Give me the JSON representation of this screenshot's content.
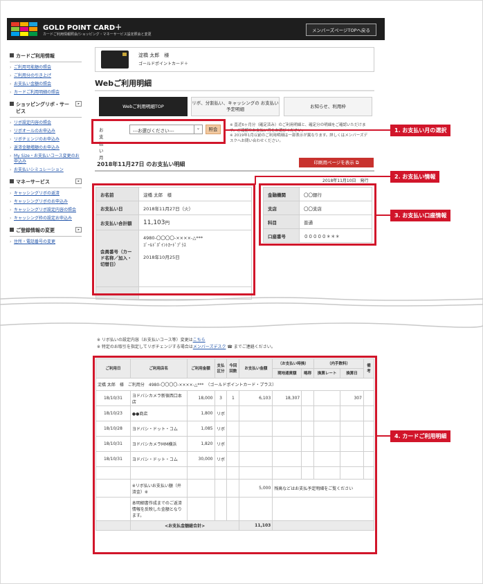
{
  "header": {
    "brand": "GOLD POINT CARD＋",
    "subtitle": "カードご利用情報照会/ショッピング・マネーサービス設定照会と変更",
    "member_top_button": "メンバーズページTOPへ戻る"
  },
  "sidebar": {
    "sections": [
      {
        "title": "カードご利用情報",
        "has_toggle": false,
        "items": [
          "ご利用可能額の照会",
          "ご利用分の引き上げ",
          "お支払い金額の照会",
          "カードご利用明細の照会"
        ]
      },
      {
        "title": "ショッピングリボ・サービス",
        "has_toggle": true,
        "items": [
          "リボ設定内容の照会",
          "リボオールのお申込み",
          "リボチェンジのお申込み",
          "返済金額増額のお申込み",
          "My Size・お支払いコース変更のお申込み",
          "お支払いシミュレーション"
        ]
      },
      {
        "title": "マネーサービス",
        "has_toggle": true,
        "items": [
          "キャッシングリボの返済",
          "キャッシングリボのお申込み",
          "キャッシングリボ設定内容の照会",
          "キャッシング枠の設定お申込み"
        ]
      },
      {
        "title": "ご登録情報の変更",
        "has_toggle": true,
        "items": [
          "住所・電話番号の変更"
        ]
      }
    ]
  },
  "card": {
    "holder": "淀橋 太郎　様",
    "type": "ゴールドポイントカード＋"
  },
  "page_title": "Webご利用明細",
  "tabs": [
    {
      "label": "Webご利用明細TOP"
    },
    {
      "label": "リボ、分割払い、キャッシングの お支払い予定明細"
    },
    {
      "label": "お知らせ、利用枠"
    }
  ],
  "month": {
    "label": "お支払い月",
    "selected": "---お選びください---",
    "view_button": "照会"
  },
  "notes": [
    "※ 直近6ヶ月分（確定済み）のご利用明細と、確定分の明細をご確認いただけます。ご確認のお支払い月をお選びください。",
    "※ 2019年1月以前のご利用明細は一部表示が異なります。詳しくはメンバーズデスクへお問い合わせください。"
  ],
  "statement_heading": "2018年11月27日 のお支払い明細",
  "print_button": "印刷用ページを表示",
  "issue_date": "2018年11月10日　発行",
  "payment_info": {
    "name_label": "お名前",
    "name": "淀橋 太郎　様",
    "date_label": "お支払い日",
    "date": "2018年11月27日（火）",
    "total_label": "お支払い合計額",
    "total": "11,103",
    "total_unit": "円",
    "member_label": "会員番号（カード名称／加入・切替日）",
    "member_no": "4980-〇〇〇〇-××××-△***",
    "member_card": "ｺﾞｰﾙﾄﾞﾎﾟｲﾝﾄｶｰﾄﾞﾌﾟﾗｽ",
    "member_date": "2018年10月25日"
  },
  "bank_info": {
    "bank_label": "金融機関",
    "bank": "〇〇銀行",
    "branch_label": "支店",
    "branch": "〇〇支店",
    "type_label": "科目",
    "type": "普通",
    "acct_label": "口座番号",
    "acct": "０００００＊＊＊"
  },
  "callouts": [
    "1. お支払い月の選択",
    "2. お支払い情報",
    "3. お支払い口座情報",
    "4. カードご利用明細"
  ],
  "lower_notes": {
    "line1_prefix": "※ リボ払いの設定内容（お支払いコース等）変更は",
    "line1_link": "こちら",
    "line2_prefix": "※ 特定のお取引を指定してリボチェンジする場合は",
    "line2_link": "メンバーズデスク",
    "line2_suffix": "までご連絡ください。"
  },
  "stmt": {
    "headers": {
      "date": "ご利用日",
      "shop": "ご利用店名",
      "amount": "ご利用金額",
      "kind": "支払区分",
      "count": "今回回数",
      "pay": "お支払い金額",
      "fx_group": "（お支払い時換）",
      "fx_local": "現地通貨額",
      "fx_abbr": "略称",
      "fee_group": "（内手数料）",
      "fee_rate": "換算レート",
      "fee_date": "換算日",
      "note": "備考"
    },
    "member_line": "淀橋 太郎　様　ご利用分　4980-〇〇〇〇-××××-△***　（ゴールドポイントカード・プラス）",
    "rows": [
      {
        "date": "18/10/31",
        "shop": "ヨドバシカメラ新宿西口本店",
        "amount": "18,000",
        "kind": "3",
        "count": "1",
        "pay": "6,103",
        "local": "18,307",
        "fee": "307"
      },
      {
        "date": "18/10/23",
        "shop": "●●商店",
        "amount": "1,800",
        "kind": "リボ",
        "count": "",
        "pay": "",
        "local": "",
        "fee": ""
      },
      {
        "date": "18/10/28",
        "shop": "ヨドバシ・ドット・コム",
        "amount": "1,085",
        "kind": "リボ",
        "count": "",
        "pay": "",
        "local": "",
        "fee": ""
      },
      {
        "date": "18/10/31",
        "shop": "ヨドバシカメラMM横浜",
        "amount": "1,820",
        "kind": "リボ",
        "count": "",
        "pay": "",
        "local": "",
        "fee": ""
      },
      {
        "date": "18/10/31",
        "shop": "ヨドバシ・ドット・コム",
        "amount": "30,000",
        "kind": "リボ",
        "count": "",
        "pay": "",
        "local": "",
        "fee": ""
      }
    ],
    "revo_label": "※リボ払いお支払い額（弁済金）※",
    "revo_amount": "5,000",
    "revo_note": "残高などはお支払予定明細をご覧ください",
    "footnote": "本明細書作成までのご返済情報を反映した金額となります。",
    "total_label": "<お支払金額総合計>",
    "total": "11,103"
  }
}
